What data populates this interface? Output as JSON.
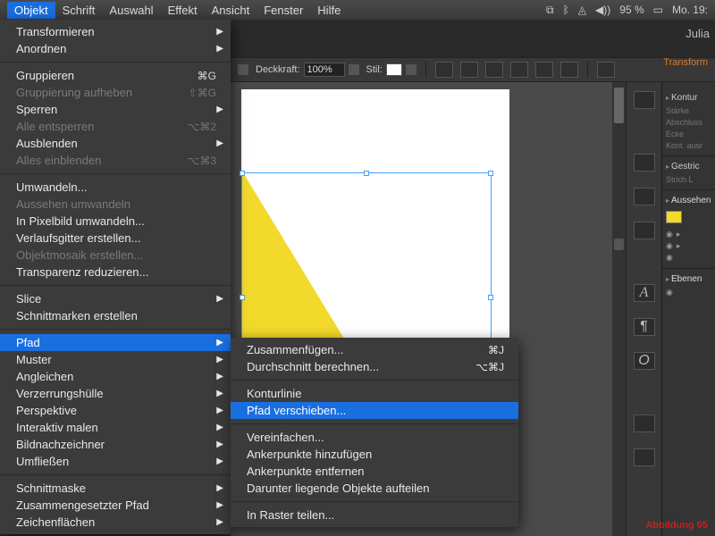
{
  "menubar": {
    "items": [
      "Objekt",
      "Schrift",
      "Auswahl",
      "Effekt",
      "Ansicht",
      "Fenster",
      "Hilfe"
    ],
    "active_index": 0,
    "status": {
      "battery": "95 %",
      "clock": "Mo. 19:"
    }
  },
  "app": {
    "username": "Julia"
  },
  "toolbar": {
    "opacity_label": "Deckkraft:",
    "opacity_value": "100%",
    "style_label": "Stil:",
    "tab_label": "Transform"
  },
  "objekt_menu": [
    {
      "label": "Transformieren",
      "sub": true
    },
    {
      "label": "Anordnen",
      "sub": true
    },
    {
      "sep": true
    },
    {
      "label": "Gruppieren",
      "short": "⌘G"
    },
    {
      "label": "Gruppierung aufheben",
      "short": "⇧⌘G",
      "disabled": true
    },
    {
      "label": "Sperren",
      "sub": true
    },
    {
      "label": "Alle entsperren",
      "short": "⌥⌘2",
      "disabled": true
    },
    {
      "label": "Ausblenden",
      "sub": true
    },
    {
      "label": "Alles einblenden",
      "short": "⌥⌘3",
      "disabled": true
    },
    {
      "sep": true
    },
    {
      "label": "Umwandeln..."
    },
    {
      "label": "Aussehen umwandeln",
      "disabled": true
    },
    {
      "label": "In Pixelbild umwandeln..."
    },
    {
      "label": "Verlaufsgitter erstellen..."
    },
    {
      "label": "Objektmosaik erstellen...",
      "disabled": true
    },
    {
      "label": "Transparenz reduzieren..."
    },
    {
      "sep": true
    },
    {
      "label": "Slice",
      "sub": true
    },
    {
      "label": "Schnittmarken erstellen"
    },
    {
      "sep": true
    },
    {
      "label": "Pfad",
      "sub": true,
      "hi": true
    },
    {
      "label": "Muster",
      "sub": true
    },
    {
      "label": "Angleichen",
      "sub": true
    },
    {
      "label": "Verzerrungshülle",
      "sub": true
    },
    {
      "label": "Perspektive",
      "sub": true
    },
    {
      "label": "Interaktiv malen",
      "sub": true
    },
    {
      "label": "Bildnachzeichner",
      "sub": true
    },
    {
      "label": "Umfließen",
      "sub": true
    },
    {
      "sep": true
    },
    {
      "label": "Schnittmaske",
      "sub": true
    },
    {
      "label": "Zusammengesetzter Pfad",
      "sub": true
    },
    {
      "label": "Zeichenflächen",
      "sub": true
    }
  ],
  "pfad_submenu": [
    {
      "label": "Zusammenfügen...",
      "short": "⌘J"
    },
    {
      "label": "Durchschnitt berechnen...",
      "short": "⌥⌘J"
    },
    {
      "sep": true
    },
    {
      "label": "Konturlinie"
    },
    {
      "label": "Pfad verschieben...",
      "hi": true
    },
    {
      "sep": true
    },
    {
      "label": "Vereinfachen..."
    },
    {
      "label": "Ankerpunkte hinzufügen"
    },
    {
      "label": "Ankerpunkte entfernen"
    },
    {
      "label": "Darunter liegende Objekte aufteilen"
    },
    {
      "sep": true
    },
    {
      "label": "In Raster teilen..."
    }
  ],
  "panels": {
    "kontur": {
      "title": "Kontur",
      "rows": [
        "Stärke",
        "Abschluss",
        "Ecke",
        "Kont. ausr"
      ]
    },
    "gestrichelt": {
      "title": "Gestric",
      "rows": [
        "Strich  L"
      ]
    },
    "aussehen": {
      "title": "Aussehen"
    },
    "ebenen": {
      "title": "Ebenen"
    }
  },
  "watermark": "Abbildung 05"
}
